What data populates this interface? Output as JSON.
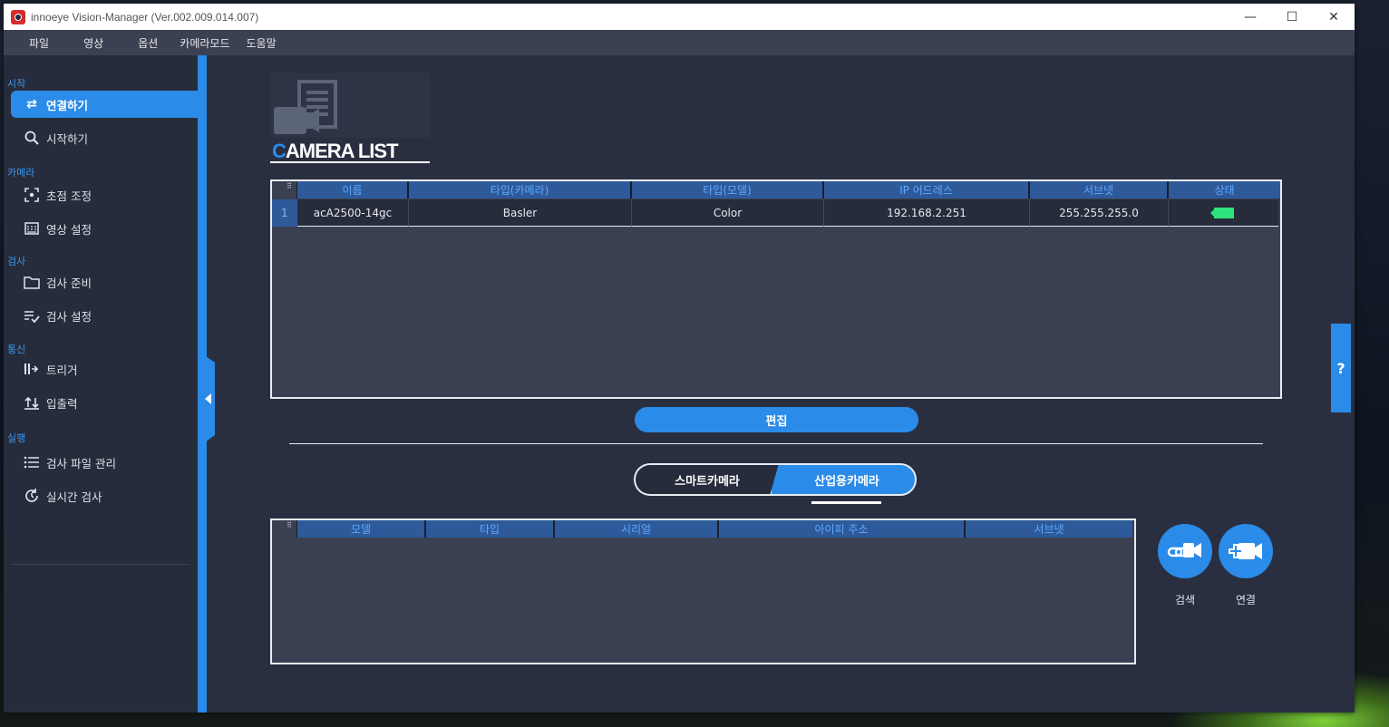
{
  "window": {
    "title": "innoeye Vision-Manager (Ver.002.009.014.007)",
    "controls": {
      "minimize": "—",
      "maximize": "☐",
      "close": "✕"
    }
  },
  "menu": [
    "파일",
    "영상",
    "옵션",
    "카메라모드",
    "도움말"
  ],
  "sidebar": {
    "sections": [
      {
        "label": "시작",
        "items": [
          {
            "label": "연결하기",
            "icon": "swap-arrows-icon",
            "active": true
          },
          {
            "label": "시작하기",
            "icon": "search-icon"
          }
        ]
      },
      {
        "label": "카메라",
        "items": [
          {
            "label": "초점 조정",
            "icon": "focus-icon"
          },
          {
            "label": "영상 설정",
            "icon": "image-settings-icon"
          }
        ]
      },
      {
        "label": "검사",
        "items": [
          {
            "label": "검사 준비",
            "icon": "folder-icon"
          },
          {
            "label": "검사 설정",
            "icon": "checklist-icon"
          }
        ]
      },
      {
        "label": "통신",
        "items": [
          {
            "label": "트리거",
            "icon": "trigger-icon"
          },
          {
            "label": "입출력",
            "icon": "io-arrows-icon"
          }
        ]
      },
      {
        "label": "실행",
        "items": [
          {
            "label": "검사 파일 관리",
            "icon": "list-icon"
          },
          {
            "label": "실시간 검사",
            "icon": "refresh-clock-icon"
          }
        ]
      }
    ]
  },
  "main": {
    "heading_first": "C",
    "heading_rest": "AMERA LIST",
    "camera_table": {
      "columns": [
        "이름",
        "타입(카메라)",
        "타입(모델)",
        "IP 어드레스",
        "서브넷",
        "상태"
      ],
      "rows": [
        {
          "index": "1",
          "name": "acA2500-14gc",
          "camera_type": "Basler",
          "model_type": "Color",
          "ip": "192.168.2.251",
          "subnet": "255.255.255.0",
          "status": "connected"
        }
      ]
    },
    "edit_button": "편집",
    "tabs": {
      "left": "스마트카메라",
      "right": "산업용카메라",
      "selected": "right"
    },
    "discovery_table": {
      "columns": [
        "모델",
        "타입",
        "시리얼",
        "아이피 주소",
        "서브넷"
      ],
      "rows": []
    },
    "search_label": "검색",
    "connect_label": "연결"
  },
  "help_label": "?",
  "colors": {
    "accent": "#2b8be8",
    "status_ok": "#2ee27c",
    "bg": "#292f40"
  }
}
